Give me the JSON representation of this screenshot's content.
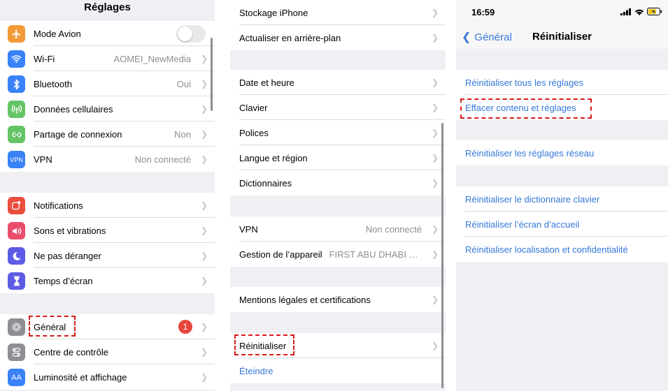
{
  "panel1": {
    "title": "Réglages",
    "group1": [
      {
        "label": "Mode Avion",
        "icon": "airplane-icon",
        "color": "#f19a37"
      },
      {
        "label": "Wi-Fi",
        "value": "AOMEI_NewMedia",
        "icon": "wifi-icon",
        "color": "#3a82f7"
      },
      {
        "label": "Bluetooth",
        "value": "Oui",
        "icon": "bluetooth-icon",
        "color": "#3a82f7"
      },
      {
        "label": "Données cellulaires",
        "icon": "cellular-icon",
        "color": "#65c466"
      },
      {
        "label": "Partage de connexion",
        "value": "Non",
        "icon": "hotspot-icon",
        "color": "#65c466"
      },
      {
        "label": "VPN",
        "value": "Non connecté",
        "icon": "vpn-icon",
        "icon_text": "VPN",
        "color": "#3a82f7"
      }
    ],
    "group2": [
      {
        "label": "Notifications",
        "icon": "notifications-icon",
        "color": "#ea4e3d"
      },
      {
        "label": "Sons et vibrations",
        "icon": "sound-icon",
        "color": "#ea4e6a"
      },
      {
        "label": "Ne pas déranger",
        "icon": "moon-icon",
        "color": "#5e5ce6"
      },
      {
        "label": "Temps d’écran",
        "icon": "hourglass-icon",
        "color": "#5e5ce6"
      }
    ],
    "group3": [
      {
        "label": "Général",
        "badge": "1",
        "icon": "gear-icon",
        "color": "#8e8e93"
      },
      {
        "label": "Centre de contrôle",
        "icon": "switches-icon",
        "color": "#8e8e93"
      },
      {
        "label": "Luminosité et affichage",
        "icon": "brightness-icon",
        "icon_text": "AA",
        "color": "#3a82f7"
      }
    ]
  },
  "panel2": {
    "group1": [
      {
        "label": "Stockage iPhone"
      },
      {
        "label": "Actualiser en arrière-plan"
      }
    ],
    "group2": [
      {
        "label": "Date et heure"
      },
      {
        "label": "Clavier"
      },
      {
        "label": "Polices"
      },
      {
        "label": "Langue et région"
      },
      {
        "label": "Dictionnaires"
      }
    ],
    "group3": [
      {
        "label": "VPN",
        "value": "Non connecté"
      },
      {
        "label": "Gestion de l’appareil",
        "value": "FIRST ABU DHABI BAN..."
      }
    ],
    "group4": [
      {
        "label": "Mentions légales et certifications"
      }
    ],
    "group5": [
      {
        "label": "Réinitialiser"
      },
      {
        "label": "Éteindre",
        "link": true
      }
    ]
  },
  "panel3": {
    "time": "16:59",
    "back_label": "Général",
    "title": "Réinitialiser",
    "group1": [
      {
        "label": "Réinitialiser tous les réglages"
      },
      {
        "label": "Effacer contenu et réglages"
      }
    ],
    "group2": [
      {
        "label": "Réinitialiser les réglages réseau"
      }
    ],
    "group3": [
      {
        "label": "Réinitialiser le dictionnaire clavier"
      },
      {
        "label": "Réinitialiser l’écran d’accueil"
      },
      {
        "label": "Réinitialiser localisation et confidentialité"
      }
    ]
  },
  "colors": {
    "accent": "#3478d8",
    "highlight": "#d81818",
    "badge": "#e6463c"
  }
}
